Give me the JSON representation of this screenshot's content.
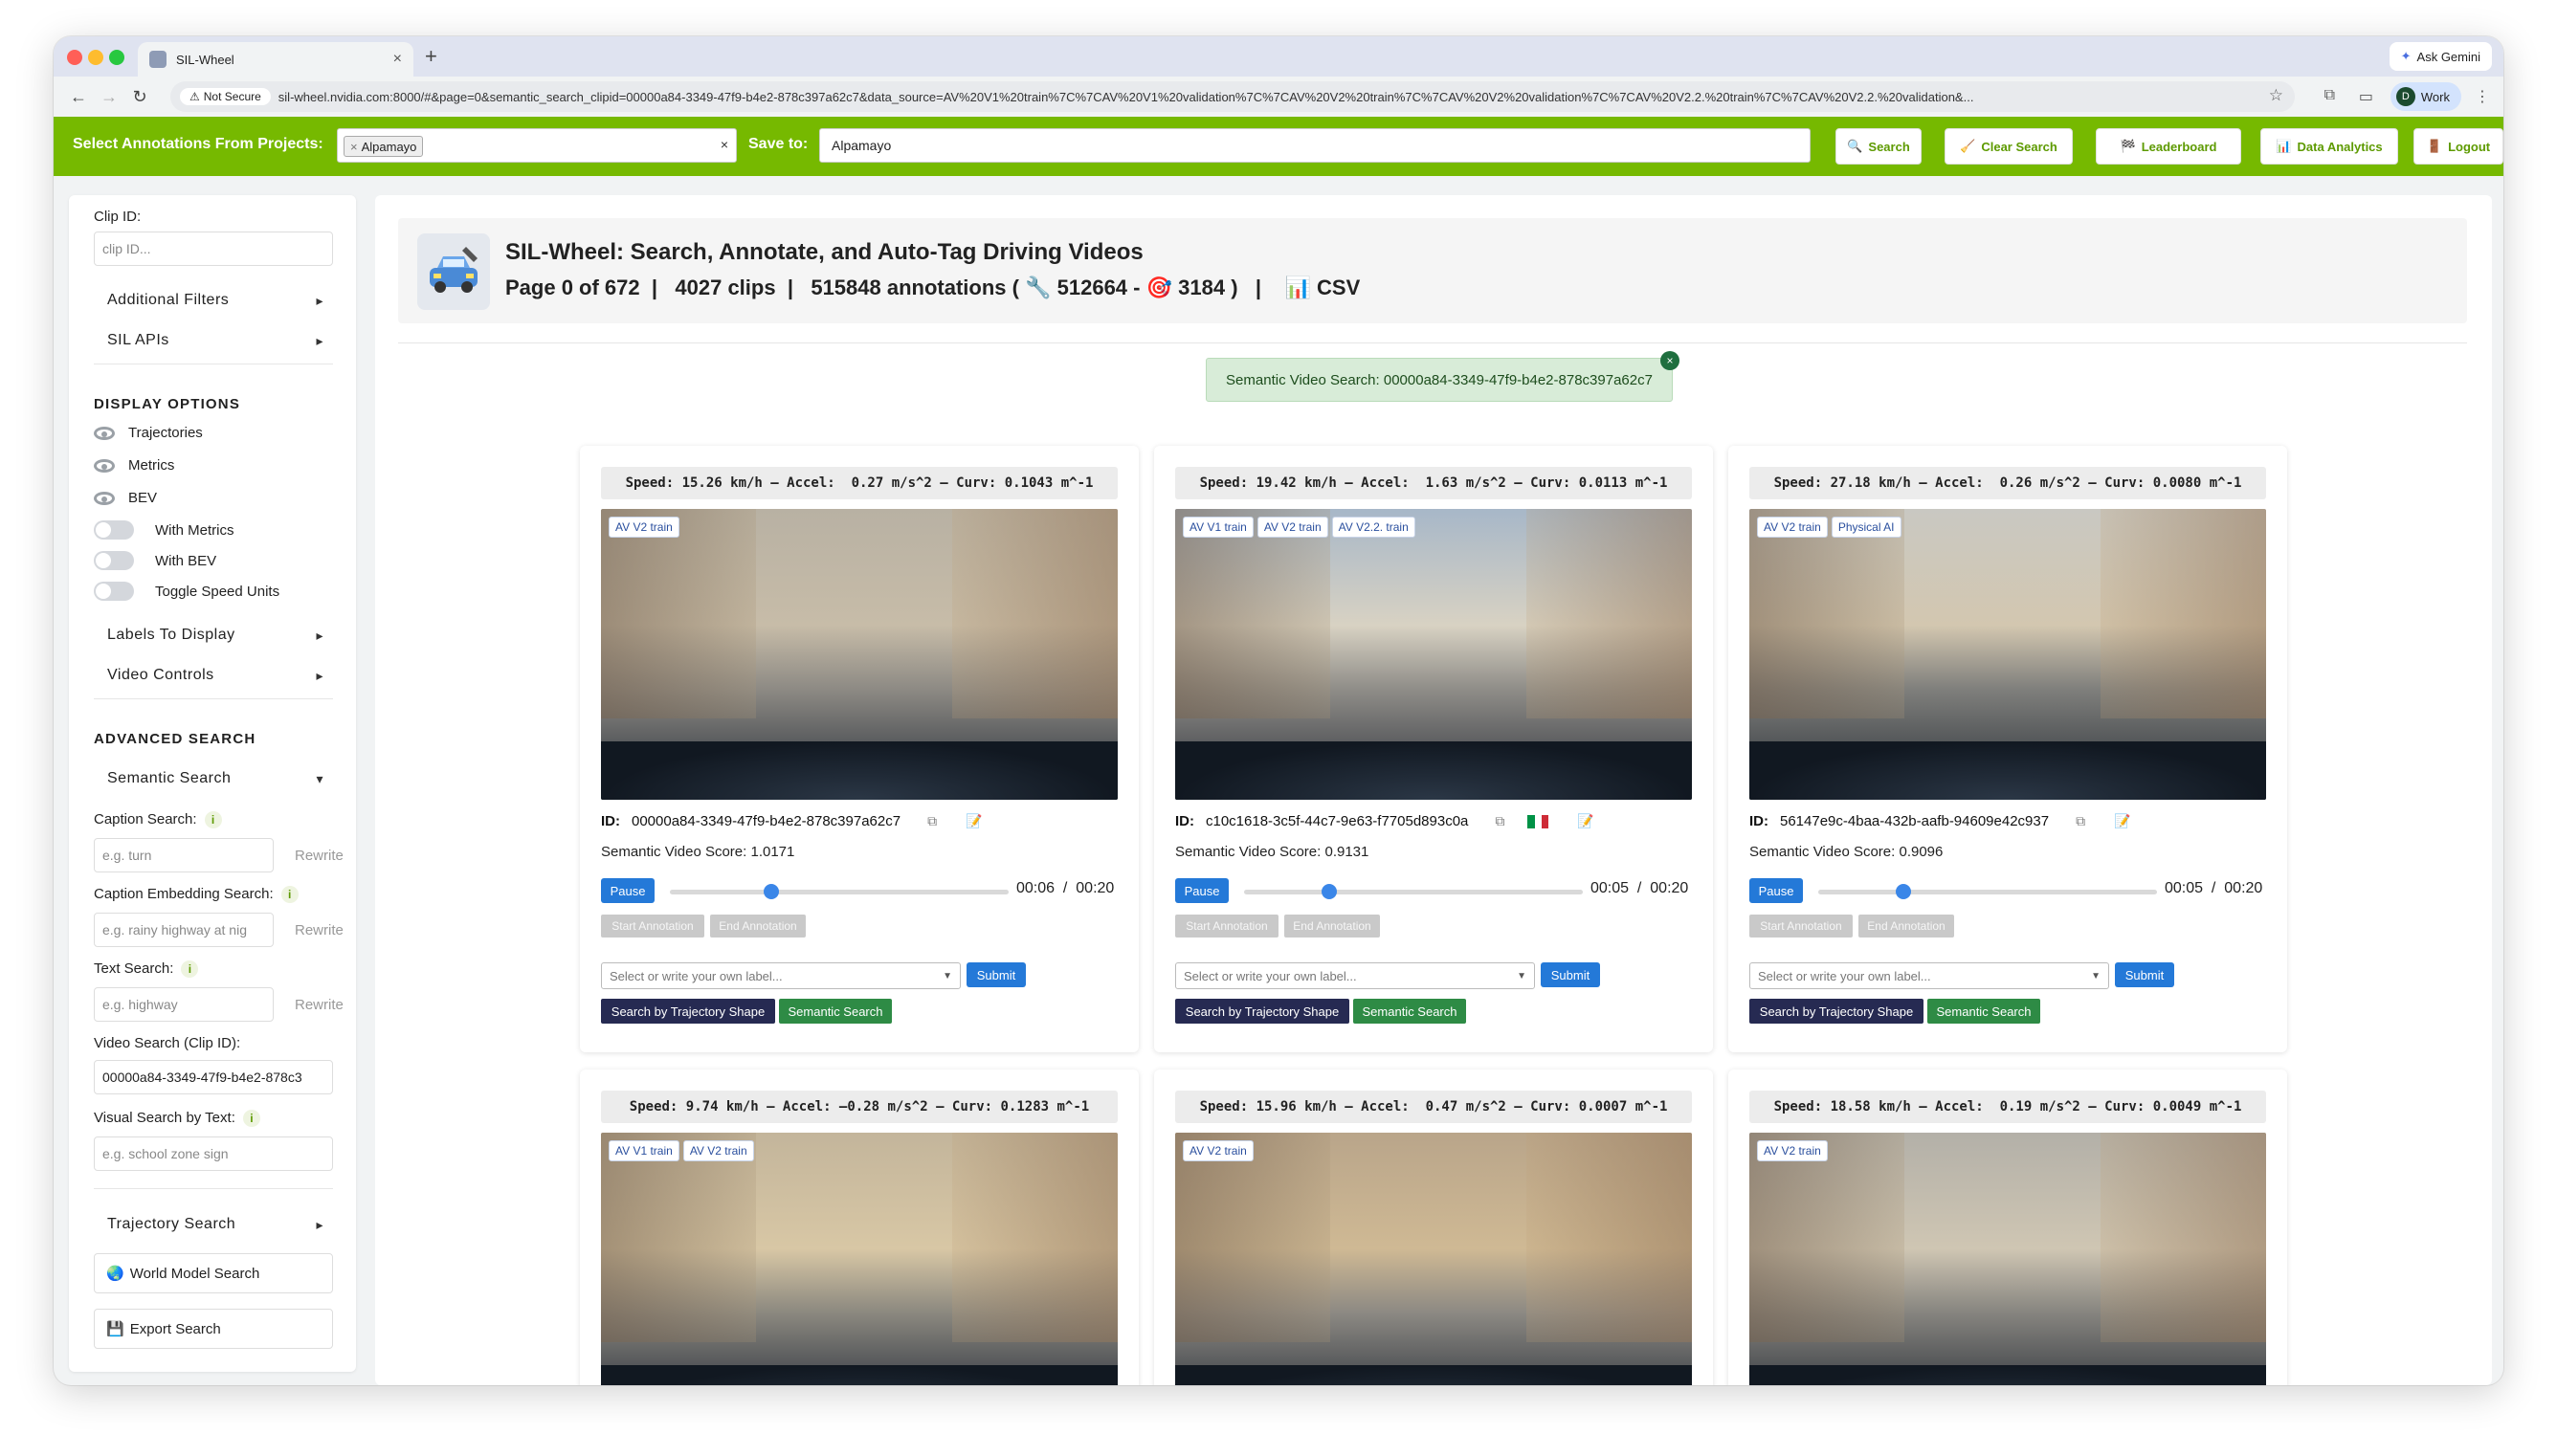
{
  "browser": {
    "tab_title": "SIL-Wheel",
    "gemini_label": "Ask Gemini",
    "not_secure": "Not Secure",
    "url": "sil-wheel.nvidia.com:8000/#&page=0&semantic_search_clipid=00000a84-3349-47f9-b4e2-878c397a62c7&data_source=AV%20V1%20train%7C%7CAV%20V1%20validation%7C%7CAV%20V2%20train%7C%7CAV%20V2%20validation%7C%7CAV%20V2.2.%20train%7C%7CAV%20V2.2.%20validation&...",
    "profile_initial": "D",
    "profile_label": "Work"
  },
  "header": {
    "projects_label": "Select Annotations From Projects:",
    "project_chip": "Alpamayo",
    "save_label": "Save to:",
    "save_value": "Alpamayo",
    "buttons": {
      "search": "Search",
      "clear": "Clear Search",
      "leaderboard": "Leaderboard",
      "analytics": "Data Analytics",
      "logout": "Logout"
    }
  },
  "sidebar": {
    "clip_id_label": "Clip ID:",
    "clip_id_placeholder": "clip ID...",
    "additional_filters": "Additional Filters",
    "sil_apis": "SIL APIs",
    "display_options_heading": "DISPLAY OPTIONS",
    "display_options": [
      "Trajectories",
      "Metrics",
      "BEV"
    ],
    "toggles": [
      "With Metrics",
      "With BEV",
      "Toggle Speed Units"
    ],
    "labels_to_display": "Labels To Display",
    "video_controls": "Video Controls",
    "advanced_heading": "ADVANCED SEARCH",
    "semantic_search": "Semantic Search",
    "caption_search_label": "Caption Search:",
    "caption_search_placeholder": "e.g. turn",
    "caption_embedding_label": "Caption Embedding Search:",
    "caption_embedding_placeholder": "e.g. rainy highway at nig",
    "text_search_label": "Text Search:",
    "text_search_placeholder": "e.g. highway",
    "rewrite": "Rewrite",
    "video_search_label": "Video Search (Clip ID):",
    "video_search_value": "00000a84-3349-47f9-b4e2-878c3",
    "visual_search_label": "Visual Search by Text:",
    "visual_search_placeholder": "e.g. school zone sign",
    "trajectory_search": "Trajectory Search",
    "world_model_search": "World Model Search",
    "export_search": "Export Search"
  },
  "main": {
    "title": "SIL-Wheel: Search, Annotate, and Auto-Tag Driving Videos",
    "page_info": "Page 0 of 672",
    "clips": "4027 clips",
    "annotations": "515848 annotations (",
    "tool_count": "512664",
    "target_count": "3184 )",
    "csv": "CSV",
    "semantic_banner": "Semantic Video Search: 00000a84-3349-47f9-b4e2-878c397a62c7"
  },
  "cards": [
    {
      "speed": "Speed: 15.26 km/h – Accel:  0.27 m/s^2 – Curv: 0.1043 m^-1",
      "tags": [
        "AV V2 train"
      ],
      "id": "00000a84-3349-47f9-b4e2-878c397a62c7",
      "score": "Semantic Video Score: 1.0171",
      "time": "00:06  /  00:20",
      "progress": 0.3,
      "flag": false
    },
    {
      "speed": "Speed: 19.42 km/h – Accel:  1.63 m/s^2 – Curv: 0.0113 m^-1",
      "tags": [
        "AV V1 train",
        "AV V2 train",
        "AV V2.2. train"
      ],
      "id": "c10c1618-3c5f-44c7-9e63-f7705d893c0a",
      "score": "Semantic Video Score: 0.9131",
      "time": "00:05  /  00:20",
      "progress": 0.25,
      "flag": true
    },
    {
      "speed": "Speed: 27.18 km/h – Accel:  0.26 m/s^2 – Curv: 0.0080 m^-1",
      "tags": [
        "AV V2 train",
        "Physical AI"
      ],
      "id": "56147e9c-4baa-432b-aafb-94609e42c937",
      "score": "Semantic Video Score: 0.9096",
      "time": "00:05  /  00:20",
      "progress": 0.25,
      "flag": false
    },
    {
      "speed": "Speed: 9.74 km/h – Accel: –0.28 m/s^2 – Curv: 0.1283 m^-1",
      "tags": [
        "AV V1 train",
        "AV V2 train"
      ]
    },
    {
      "speed": "Speed: 15.96 km/h – Accel:  0.47 m/s^2 – Curv: 0.0007 m^-1",
      "tags": [
        "AV V2 train"
      ]
    },
    {
      "speed": "Speed: 18.58 km/h – Accel:  0.19 m/s^2 – Curv: 0.0049 m^-1",
      "tags": [
        "AV V2 train"
      ]
    }
  ],
  "card_ui": {
    "id_label": "ID:",
    "pause": "Pause",
    "start_annotation": "Start Annotation",
    "end_annotation": "End Annotation",
    "label_placeholder": "Select or write your own label...",
    "submit": "Submit",
    "traj_search": "Search by Trajectory Shape",
    "semantic_search": "Semantic Search"
  },
  "colors": {
    "brand_green": "#76b900",
    "primary_blue": "#2479d8",
    "traj_button": "#262a52",
    "semantic_button": "#2e8b45"
  }
}
